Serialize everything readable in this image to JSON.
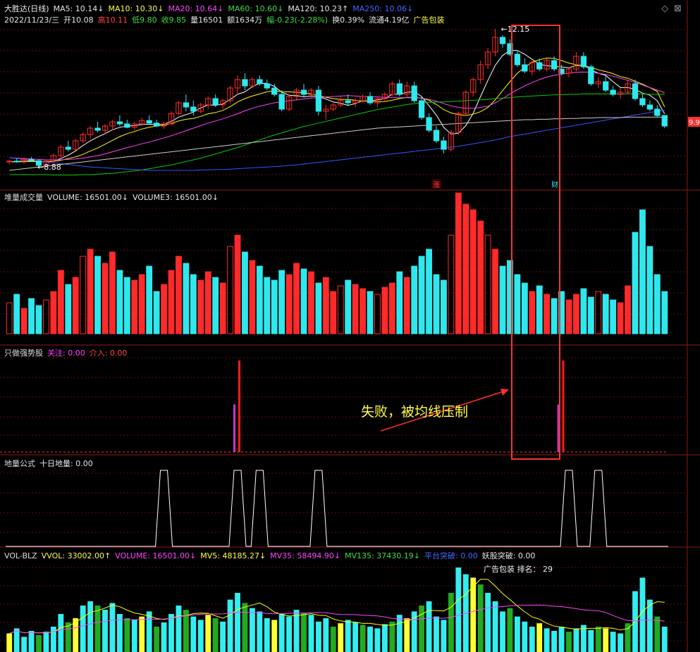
{
  "colors": {
    "up": "#ff2a2a",
    "down": "#2ee8ee",
    "ma5": "#ffffff",
    "ma10": "#ffff00",
    "ma20": "#ff44ff",
    "ma60": "#00cc00",
    "ma120": "#3355ff",
    "ma250": "#cccccc",
    "annot": "#ff3030",
    "note": "#ffff44"
  },
  "header": {
    "stock": "大胜达(日线)",
    "ma": [
      {
        "name": "MA5",
        "value": "10.14",
        "arrow": "↓",
        "color": "white"
      },
      {
        "name": "MA10",
        "value": "10.30",
        "arrow": "↓",
        "color": "yellow"
      },
      {
        "name": "MA20",
        "value": "10.64",
        "arrow": "↓",
        "color": "mag"
      },
      {
        "name": "MA60",
        "value": "10.60",
        "arrow": "↓",
        "color": "green"
      },
      {
        "name": "MA120",
        "value": "10.23",
        "arrow": "↑",
        "color": "white"
      },
      {
        "name": "MA250",
        "value": "10.06",
        "arrow": "↓",
        "color": "blue"
      }
    ],
    "info": [
      {
        "text": "2022/11/23/三",
        "color": "white"
      },
      {
        "text": "开10.08",
        "color": "white"
      },
      {
        "text": "高10.11",
        "color": "red"
      },
      {
        "text": "低9.80",
        "color": "green"
      },
      {
        "text": "收9.85",
        "color": "green"
      },
      {
        "text": "量16501",
        "color": "white"
      },
      {
        "text": "额1634万",
        "color": "white"
      },
      {
        "text": "幅-0.23(-2.28%)",
        "color": "green"
      },
      {
        "text": "换0.39%",
        "color": "white"
      },
      {
        "text": "流通4.19亿",
        "color": "white"
      },
      {
        "text": "广告包装",
        "color": "yellow"
      }
    ]
  },
  "price_labels": {
    "high": "12.15",
    "low": "8.88",
    "current": "9.9",
    "tag_zhang": "涨",
    "tag_cai": "财"
  },
  "panel2": {
    "title": "堆量成交量",
    "items": [
      {
        "text": "VOLUME: 16501.00↓",
        "color": "white"
      },
      {
        "text": "VOLUME3: 16501.00↓",
        "color": "white"
      }
    ]
  },
  "panel3": {
    "title": "只做强势股",
    "items": [
      {
        "text": "关注: 0.00",
        "color": "mag"
      },
      {
        "text": "介入: 0.00",
        "color": "red"
      }
    ]
  },
  "panel4": {
    "title": "地量公式",
    "items": [
      {
        "text": "十日地量: 0.00",
        "color": "white"
      }
    ]
  },
  "panel5": {
    "title": "VOL-BLZ",
    "items": [
      {
        "text": "VVOL: 33002.00↑",
        "color": "yellow"
      },
      {
        "text": "VOLUME: 16501.00↓",
        "color": "mag"
      },
      {
        "text": "MV5: 48185.27↓",
        "color": "yellow"
      },
      {
        "text": "MV35: 58494.90↓",
        "color": "mag"
      },
      {
        "text": "MV135: 37430.19↓",
        "color": "green"
      },
      {
        "text": "平台突破: 0.00",
        "color": "blue"
      },
      {
        "text": "妖股突破: 0.00",
        "color": "white"
      }
    ],
    "sub": "广告包装    排名： 29"
  },
  "annotation": "失败，被均线压制",
  "chart_data": {
    "type": "candlestick",
    "axis_label_right": "9.9",
    "y_range_price": [
      8.5,
      12.5
    ],
    "candles": [
      [
        9.0,
        9.05,
        8.95,
        9.02
      ],
      [
        9.02,
        9.08,
        8.98,
        9.0
      ],
      [
        9.0,
        9.1,
        8.96,
        9.06
      ],
      [
        9.06,
        9.12,
        9.0,
        9.03
      ],
      [
        9.03,
        9.06,
        8.88,
        8.92
      ],
      [
        8.92,
        9.05,
        8.9,
        9.02
      ],
      [
        9.02,
        9.2,
        9.0,
        9.15
      ],
      [
        9.15,
        9.4,
        9.1,
        9.35
      ],
      [
        9.35,
        9.5,
        9.25,
        9.3
      ],
      [
        9.3,
        9.55,
        9.28,
        9.5
      ],
      [
        9.5,
        9.7,
        9.45,
        9.65
      ],
      [
        9.65,
        9.85,
        9.55,
        9.8
      ],
      [
        9.8,
        9.95,
        9.7,
        9.75
      ],
      [
        9.75,
        9.9,
        9.65,
        9.85
      ],
      [
        9.85,
        10.0,
        9.75,
        9.95
      ],
      [
        9.95,
        10.1,
        9.85,
        9.9
      ],
      [
        9.9,
        10.0,
        9.8,
        9.82
      ],
      [
        9.82,
        9.95,
        9.75,
        9.9
      ],
      [
        9.9,
        10.05,
        9.85,
        9.98
      ],
      [
        9.98,
        10.1,
        9.9,
        9.92
      ],
      [
        9.92,
        10.0,
        9.82,
        9.85
      ],
      [
        9.85,
        9.95,
        9.78,
        9.9
      ],
      [
        9.9,
        10.2,
        9.88,
        10.15
      ],
      [
        10.15,
        10.45,
        10.1,
        10.4
      ],
      [
        10.4,
        10.6,
        10.2,
        10.3
      ],
      [
        10.3,
        10.45,
        10.1,
        10.2
      ],
      [
        10.2,
        10.4,
        10.15,
        10.35
      ],
      [
        10.35,
        10.55,
        10.25,
        10.5
      ],
      [
        10.5,
        10.6,
        10.3,
        10.35
      ],
      [
        10.35,
        10.5,
        10.25,
        10.45
      ],
      [
        10.45,
        10.8,
        10.4,
        10.75
      ],
      [
        10.75,
        11.05,
        10.6,
        10.95
      ],
      [
        10.95,
        11.1,
        10.7,
        10.8
      ],
      [
        10.8,
        11.0,
        10.75,
        10.95
      ],
      [
        10.95,
        11.05,
        10.8,
        10.85
      ],
      [
        10.85,
        10.95,
        10.7,
        10.75
      ],
      [
        10.75,
        10.85,
        10.55,
        10.6
      ],
      [
        10.6,
        10.7,
        10.2,
        10.25
      ],
      [
        10.25,
        10.6,
        10.2,
        10.55
      ],
      [
        10.55,
        10.75,
        10.45,
        10.7
      ],
      [
        10.7,
        10.85,
        10.55,
        10.6
      ],
      [
        10.6,
        10.75,
        10.5,
        10.7
      ],
      [
        10.7,
        10.8,
        10.1,
        10.2
      ],
      [
        10.2,
        10.35,
        10.0,
        10.25
      ],
      [
        10.25,
        10.4,
        10.2,
        10.35
      ],
      [
        10.35,
        10.55,
        10.3,
        10.45
      ],
      [
        10.45,
        10.6,
        10.35,
        10.4
      ],
      [
        10.4,
        10.5,
        10.3,
        10.45
      ],
      [
        10.45,
        10.6,
        10.4,
        10.55
      ],
      [
        10.55,
        10.65,
        10.35,
        10.4
      ],
      [
        10.4,
        10.55,
        10.3,
        10.5
      ],
      [
        10.5,
        10.65,
        10.45,
        10.6
      ],
      [
        10.6,
        10.9,
        10.55,
        10.85
      ],
      [
        10.85,
        10.95,
        10.55,
        10.6
      ],
      [
        10.6,
        10.9,
        10.55,
        10.8
      ],
      [
        10.8,
        10.9,
        10.4,
        10.45
      ],
      [
        10.45,
        10.55,
        10.0,
        10.05
      ],
      [
        10.05,
        10.15,
        9.7,
        9.75
      ],
      [
        9.75,
        9.85,
        9.45,
        9.5
      ],
      [
        9.5,
        9.6,
        9.2,
        9.3
      ],
      [
        9.3,
        9.75,
        9.25,
        9.7
      ],
      [
        9.7,
        10.2,
        9.65,
        10.15
      ],
      [
        10.15,
        10.7,
        10.1,
        10.65
      ],
      [
        10.65,
        11.0,
        10.55,
        10.95
      ],
      [
        10.95,
        11.4,
        10.85,
        11.3
      ],
      [
        11.3,
        11.7,
        11.2,
        11.6
      ],
      [
        11.6,
        12.15,
        11.5,
        11.95
      ],
      [
        11.95,
        12.0,
        11.7,
        11.8
      ],
      [
        11.8,
        11.9,
        11.5,
        11.55
      ],
      [
        11.55,
        11.65,
        11.25,
        11.3
      ],
      [
        11.3,
        11.45,
        11.1,
        11.15
      ],
      [
        11.15,
        11.4,
        11.05,
        11.35
      ],
      [
        11.35,
        11.45,
        11.15,
        11.2
      ],
      [
        11.2,
        11.45,
        11.15,
        11.4
      ],
      [
        11.4,
        11.5,
        11.15,
        11.2
      ],
      [
        11.2,
        11.3,
        11.05,
        11.1
      ],
      [
        11.1,
        11.25,
        11.0,
        11.2
      ],
      [
        11.2,
        11.6,
        11.15,
        11.5
      ],
      [
        11.5,
        11.6,
        11.2,
        11.25
      ],
      [
        11.25,
        11.3,
        10.8,
        10.85
      ],
      [
        10.85,
        11.0,
        10.75,
        10.9
      ],
      [
        10.9,
        11.05,
        10.65,
        10.7
      ],
      [
        10.7,
        10.8,
        10.55,
        10.6
      ],
      [
        10.6,
        10.75,
        10.5,
        10.65
      ],
      [
        10.65,
        10.95,
        10.6,
        10.85
      ],
      [
        10.85,
        10.95,
        10.45,
        10.5
      ],
      [
        10.5,
        10.6,
        10.3,
        10.35
      ],
      [
        10.35,
        10.45,
        10.2,
        10.25
      ],
      [
        10.25,
        10.35,
        10.05,
        10.1
      ],
      [
        10.1,
        10.11,
        9.8,
        9.85
      ]
    ],
    "ma_lines": {
      "MA5": [
        9.0,
        9.01,
        9.02,
        9.02,
        9.01,
        9.0,
        9.02,
        9.08,
        9.16,
        9.26,
        9.39,
        9.5,
        9.59,
        9.67,
        9.76,
        9.82,
        9.85,
        9.86,
        9.89,
        9.89,
        9.89,
        9.89,
        9.96,
        10.06,
        10.12,
        10.18,
        10.28,
        10.35,
        10.34,
        10.37,
        10.48,
        10.6,
        10.66,
        10.78,
        10.86,
        10.86,
        10.79,
        10.65,
        10.58,
        10.57,
        10.54,
        10.56,
        10.55,
        10.49,
        10.42,
        10.39,
        10.34,
        10.38,
        10.45,
        10.44,
        10.47,
        10.5,
        10.6,
        10.6,
        10.65,
        10.66,
        10.55,
        10.33,
        10.11,
        9.82,
        9.66,
        9.68,
        9.86,
        10.15,
        10.55,
        10.93,
        11.29,
        11.52,
        11.64,
        11.64,
        11.55,
        11.43,
        11.31,
        11.28,
        11.26,
        11.25,
        11.23,
        11.28,
        11.29,
        11.18,
        11.1,
        11.05,
        10.9,
        10.76,
        10.76,
        10.72,
        10.63,
        10.58,
        10.45,
        10.14
      ],
      "MA10": [
        9.0,
        9.0,
        9.01,
        9.01,
        9.01,
        9.01,
        9.01,
        9.04,
        9.08,
        9.12,
        9.18,
        9.26,
        9.33,
        9.42,
        9.51,
        9.6,
        9.67,
        9.72,
        9.78,
        9.82,
        9.85,
        9.87,
        9.91,
        9.97,
        10.01,
        10.03,
        10.08,
        10.14,
        10.17,
        10.22,
        10.31,
        10.42,
        10.5,
        10.56,
        10.61,
        10.66,
        10.69,
        10.66,
        10.66,
        10.65,
        10.64,
        10.61,
        10.57,
        10.53,
        10.5,
        10.48,
        10.48,
        10.46,
        10.44,
        10.44,
        10.43,
        10.43,
        10.46,
        10.5,
        10.53,
        10.53,
        10.51,
        10.46,
        10.36,
        10.24,
        10.16,
        10.12,
        10.1,
        10.13,
        10.19,
        10.29,
        10.47,
        10.69,
        10.9,
        11.1,
        11.24,
        11.36,
        11.42,
        11.46,
        11.45,
        11.4,
        11.34,
        11.3,
        11.28,
        11.24,
        11.18,
        11.14,
        11.09,
        11.02,
        10.98,
        10.91,
        10.84,
        10.76,
        10.67,
        10.3
      ],
      "MA20": [
        9.1,
        9.09,
        9.08,
        9.07,
        9.06,
        9.05,
        9.05,
        9.05,
        9.06,
        9.07,
        9.09,
        9.12,
        9.15,
        9.19,
        9.24,
        9.29,
        9.34,
        9.38,
        9.43,
        9.47,
        9.52,
        9.57,
        9.62,
        9.68,
        9.74,
        9.8,
        9.86,
        9.92,
        9.97,
        10.02,
        10.08,
        10.14,
        10.21,
        10.27,
        10.32,
        10.36,
        10.4,
        10.42,
        10.45,
        10.47,
        10.49,
        10.51,
        10.53,
        10.54,
        10.55,
        10.56,
        10.57,
        10.56,
        10.55,
        10.55,
        10.54,
        10.53,
        10.52,
        10.52,
        10.52,
        10.52,
        10.51,
        10.48,
        10.44,
        10.38,
        10.33,
        10.29,
        10.27,
        10.27,
        10.29,
        10.32,
        10.4,
        10.5,
        10.61,
        10.71,
        10.8,
        10.88,
        10.95,
        11.01,
        11.05,
        11.08,
        11.1,
        11.12,
        11.13,
        11.12,
        11.1,
        11.07,
        11.03,
        10.98,
        10.93,
        10.88,
        10.82,
        10.76,
        10.7,
        10.64
      ],
      "MA60": [
        8.7,
        8.7,
        8.7,
        8.7,
        8.7,
        8.7,
        8.69,
        8.69,
        8.69,
        8.69,
        8.7,
        8.7,
        8.71,
        8.72,
        8.73,
        8.75,
        8.77,
        8.79,
        8.81,
        8.84,
        8.87,
        8.9,
        8.93,
        8.97,
        9.01,
        9.05,
        9.09,
        9.14,
        9.19,
        9.24,
        9.29,
        9.34,
        9.4,
        9.46,
        9.52,
        9.58,
        9.64,
        9.69,
        9.74,
        9.79,
        9.84,
        9.88,
        9.92,
        9.96,
        10.0,
        10.04,
        10.08,
        10.12,
        10.16,
        10.2,
        10.24,
        10.27,
        10.3,
        10.33,
        10.36,
        10.38,
        10.4,
        10.41,
        10.42,
        10.42,
        10.43,
        10.44,
        10.45,
        10.46,
        10.47,
        10.48,
        10.5,
        10.51,
        10.52,
        10.54,
        10.55,
        10.56,
        10.57,
        10.58,
        10.59,
        10.59,
        10.6,
        10.6,
        10.61,
        10.61,
        10.61,
        10.61,
        10.61,
        10.61,
        10.61,
        10.61,
        10.61,
        10.6,
        10.6,
        10.6
      ],
      "MA120": [
        9.1,
        9.08,
        9.06,
        9.04,
        9.02,
        9.0,
        8.98,
        8.96,
        8.94,
        8.92,
        8.9,
        8.88,
        8.87,
        8.86,
        8.85,
        8.84,
        8.83,
        8.82,
        8.81,
        8.8,
        8.8,
        8.8,
        8.8,
        8.8,
        8.8,
        8.8,
        8.81,
        8.81,
        8.82,
        8.82,
        8.83,
        8.84,
        8.85,
        8.86,
        8.87,
        8.88,
        8.89,
        8.9,
        8.92,
        8.93,
        8.95,
        8.97,
        8.99,
        9.01,
        9.03,
        9.05,
        9.07,
        9.09,
        9.11,
        9.13,
        9.15,
        9.17,
        9.19,
        9.21,
        9.23,
        9.25,
        9.27,
        9.29,
        9.31,
        9.33,
        9.35,
        9.37,
        9.4,
        9.43,
        9.46,
        9.49,
        9.52,
        9.56,
        9.6,
        9.63,
        9.66,
        9.69,
        9.72,
        9.75,
        9.78,
        9.81,
        9.84,
        9.87,
        9.9,
        9.93,
        9.96,
        9.99,
        10.02,
        10.05,
        10.08,
        10.11,
        10.14,
        10.17,
        10.2,
        10.23
      ],
      "MA250": [
        8.8,
        8.82,
        8.84,
        8.86,
        8.88,
        8.9,
        8.92,
        8.94,
        8.96,
        8.98,
        9.0,
        9.02,
        9.04,
        9.06,
        9.08,
        9.1,
        9.12,
        9.14,
        9.16,
        9.18,
        9.2,
        9.22,
        9.24,
        9.26,
        9.28,
        9.3,
        9.32,
        9.34,
        9.36,
        9.38,
        9.4,
        9.42,
        9.44,
        9.46,
        9.48,
        9.5,
        9.52,
        9.54,
        9.56,
        9.58,
        9.6,
        9.62,
        9.64,
        9.66,
        9.68,
        9.7,
        9.72,
        9.74,
        9.76,
        9.78,
        9.8,
        9.81,
        9.82,
        9.83,
        9.84,
        9.85,
        9.86,
        9.87,
        9.88,
        9.89,
        9.9,
        9.91,
        9.92,
        9.93,
        9.94,
        9.95,
        9.96,
        9.97,
        9.98,
        9.99,
        10.0,
        10.0,
        10.01,
        10.01,
        10.02,
        10.02,
        10.03,
        10.03,
        10.04,
        10.04,
        10.05,
        10.05,
        10.05,
        10.05,
        10.06,
        10.06,
        10.06,
        10.06,
        10.06,
        10.06
      ]
    },
    "volume": [
      22,
      28,
      18,
      25,
      20,
      24,
      30,
      45,
      35,
      40,
      55,
      60,
      55,
      50,
      58,
      45,
      40,
      38,
      42,
      48,
      30,
      35,
      45,
      55,
      50,
      42,
      38,
      44,
      40,
      36,
      62,
      70,
      58,
      52,
      48,
      40,
      38,
      45,
      42,
      50,
      46,
      44,
      36,
      40,
      30,
      34,
      38,
      35,
      32,
      30,
      28,
      33,
      36,
      44,
      40,
      48,
      55,
      60,
      42,
      38,
      70,
      100,
      92,
      88,
      80,
      70,
      60,
      48,
      52,
      42,
      36,
      30,
      34,
      28,
      25,
      30,
      24,
      28,
      32,
      26,
      30,
      28,
      24,
      22,
      34,
      72,
      88,
      62,
      42,
      30
    ],
    "signal_guanzhu": [
      0,
      0,
      0,
      0,
      0,
      0,
      0,
      0,
      0,
      0,
      0,
      0,
      0,
      0,
      0,
      0,
      0,
      0,
      0,
      0,
      0,
      0,
      0,
      0,
      0,
      0,
      0,
      0,
      0,
      0,
      0,
      0,
      0,
      0,
      0,
      0,
      0,
      0,
      0,
      0,
      0,
      0,
      0,
      0,
      0,
      0,
      0,
      0,
      0,
      0,
      0,
      0,
      0,
      0,
      0,
      0,
      0,
      0,
      0,
      0,
      0,
      0,
      0,
      0,
      0,
      0,
      0,
      0,
      0,
      0,
      0,
      0,
      0,
      0,
      0,
      0,
      0,
      0,
      0,
      0,
      0,
      0,
      0,
      0,
      0,
      0,
      0,
      0,
      0,
      0
    ],
    "signal_points": [
      {
        "index": 31,
        "guanzhu": 0.52,
        "jieru": 1.0
      },
      {
        "index": 75,
        "guanzhu": 0.52,
        "jieru": 1.0
      }
    ],
    "diliang_peaks": [
      21,
      31,
      34,
      42,
      76,
      80
    ]
  }
}
